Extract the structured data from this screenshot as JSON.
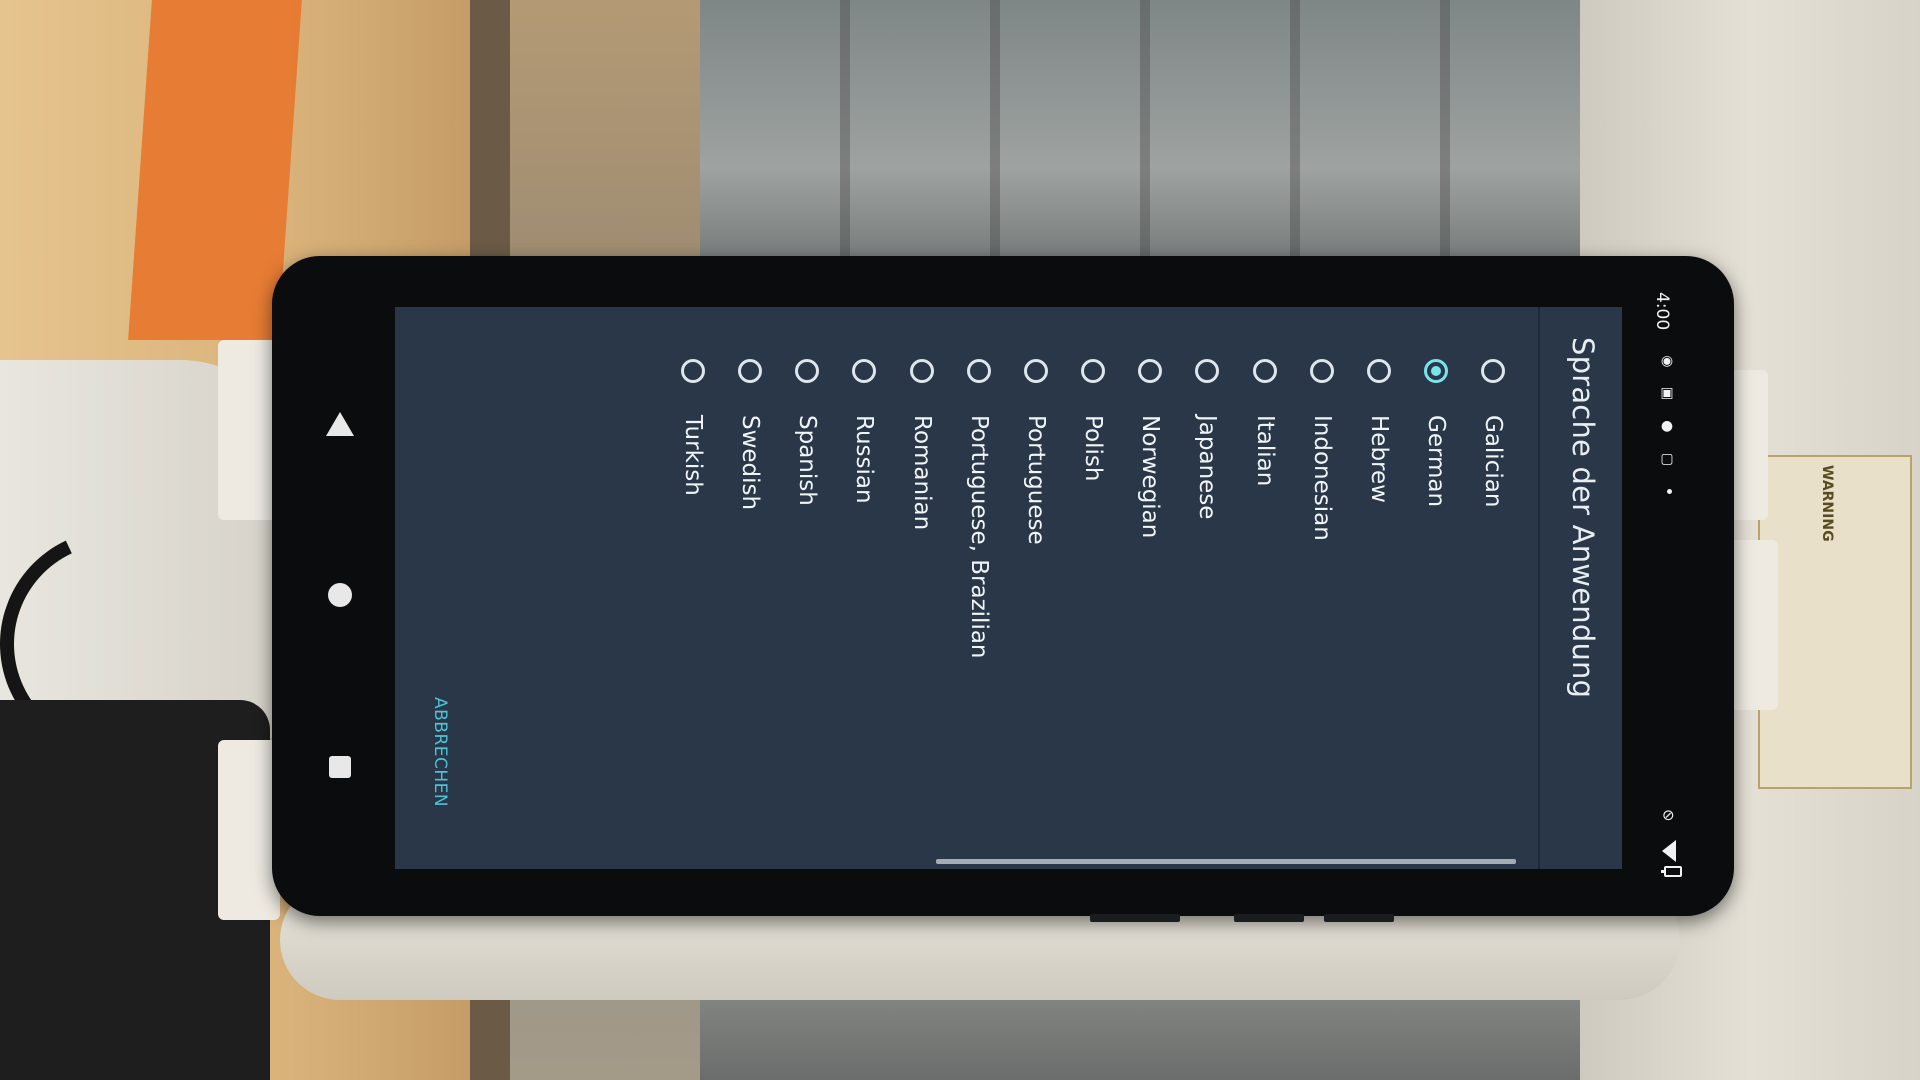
{
  "status_bar": {
    "time": "4:00"
  },
  "dialog": {
    "title": "Sprache der Anwendung",
    "options": [
      {
        "label": "Galician",
        "selected": false
      },
      {
        "label": "German",
        "selected": true
      },
      {
        "label": "Hebrew",
        "selected": false
      },
      {
        "label": "Indonesian",
        "selected": false
      },
      {
        "label": "Italian",
        "selected": false
      },
      {
        "label": "Japanese",
        "selected": false
      },
      {
        "label": "Norwegian",
        "selected": false
      },
      {
        "label": "Polish",
        "selected": false
      },
      {
        "label": "Portuguese",
        "selected": false
      },
      {
        "label": "Portuguese, Brazilian",
        "selected": false
      },
      {
        "label": "Romanian",
        "selected": false
      },
      {
        "label": "Russian",
        "selected": false
      },
      {
        "label": "Spanish",
        "selected": false
      },
      {
        "label": "Swedish",
        "selected": false
      },
      {
        "label": "Turkish",
        "selected": false
      }
    ],
    "cancel_label": "ABBRECHEN",
    "accent_color": "#7be3ec",
    "background_color": "#293749"
  },
  "navigation": {
    "icons": [
      "back-icon",
      "home-icon",
      "recents-icon"
    ]
  },
  "sticker_text": "WARNING"
}
